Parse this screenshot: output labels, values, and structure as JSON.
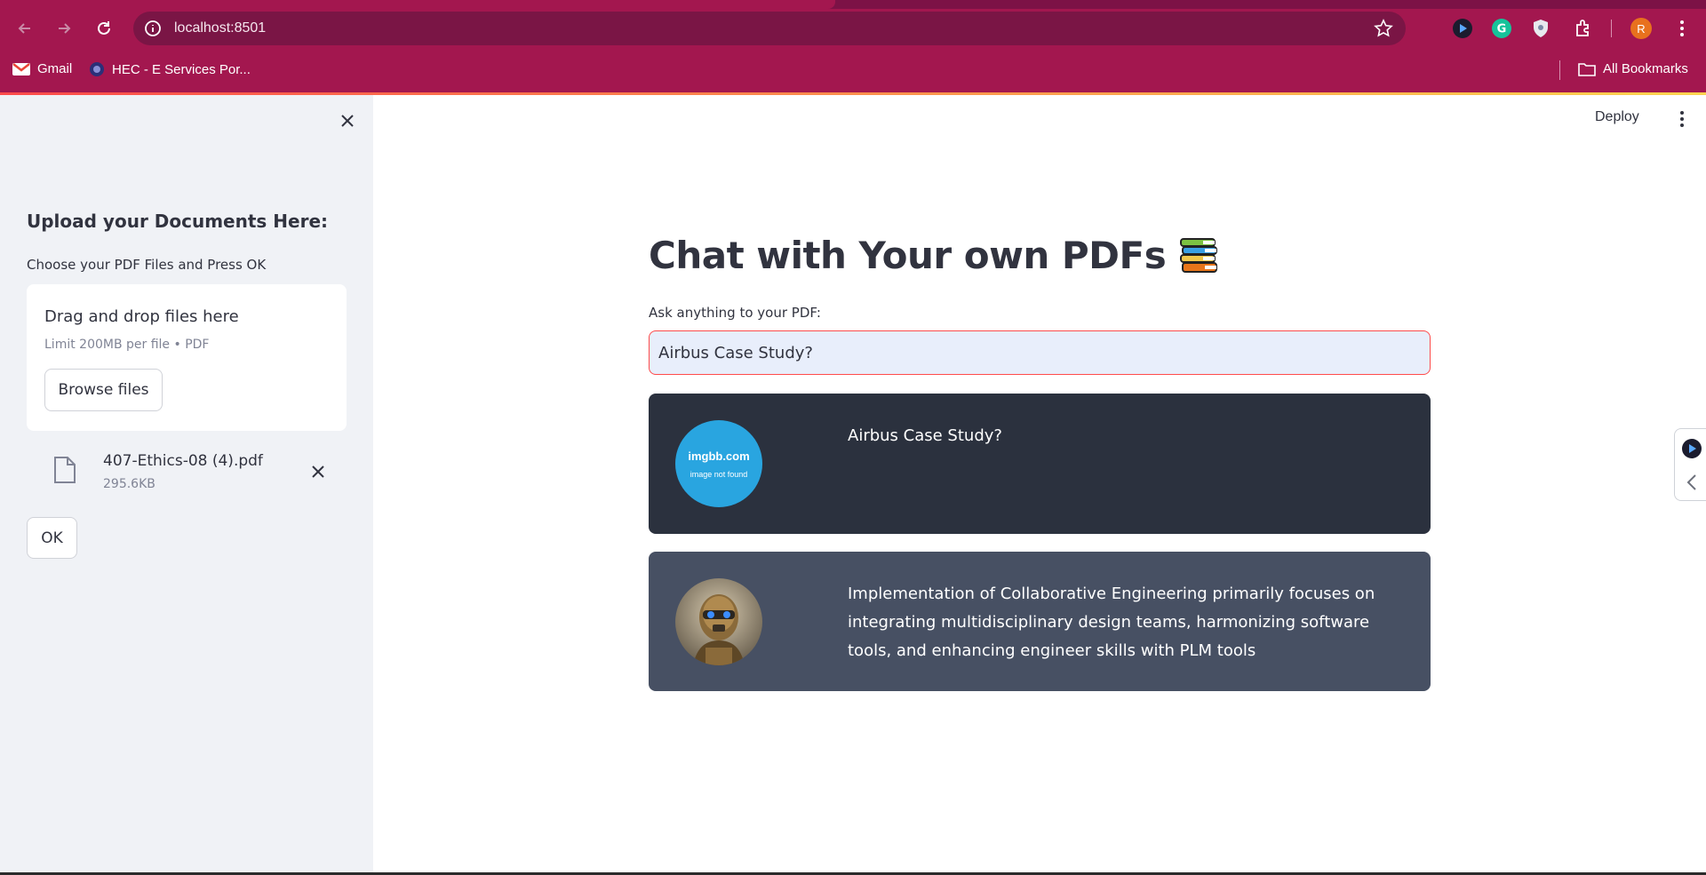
{
  "browser": {
    "url": "localhost:8501",
    "profile_initial": "R",
    "bookmarks": [
      {
        "label": "Gmail",
        "icon": "gmail-icon"
      },
      {
        "label": "HEC - E Services Por...",
        "icon": "hec-icon"
      }
    ],
    "all_bookmarks_label": "All Bookmarks",
    "colors": {
      "toolbar": "#a3174f",
      "omnibox": "#7a1545"
    }
  },
  "sidebar": {
    "heading": "Upload your Documents Here:",
    "uploader_label": "Choose your PDF Files and Press OK",
    "dropzone_title": "Drag and drop files here",
    "dropzone_limit": "Limit 200MB per file • PDF",
    "browse_label": "Browse files",
    "file": {
      "name": "407-Ethics-08 (4).pdf",
      "size": "295.6KB"
    },
    "ok_label": "OK"
  },
  "header": {
    "deploy_label": "Deploy"
  },
  "main": {
    "title": "Chat with Your own PDFs",
    "title_icon": "books-icon",
    "question_label": "Ask anything to your PDF:",
    "question_value": "Airbus Case Study?",
    "messages": [
      {
        "role": "user",
        "avatar_text_1": "imgbb.com",
        "avatar_text_2": "image not found",
        "text": "Airbus Case Study?"
      },
      {
        "role": "bot",
        "avatar": "robot-avatar",
        "text": "Implementation of Collaborative Engineering primarily focuses on integrating multidisciplinary design teams, harmonizing software tools, and enhancing engineer skills with PLM tools"
      }
    ]
  }
}
